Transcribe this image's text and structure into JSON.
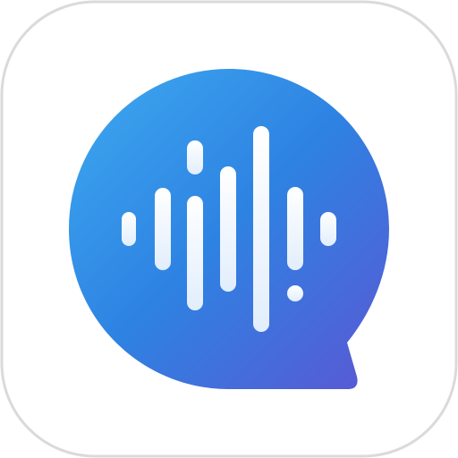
{
  "icon": {
    "name": "voice-chat-app-icon",
    "tile_color": "#FFFFFF",
    "tile_border_color": "#DADADA",
    "gradient_colors": [
      "#3DAAF0",
      "#2E7FE0",
      "#5B57D3"
    ],
    "bar_colors": [
      "#FFFFFF",
      "#E2EEFC"
    ]
  }
}
